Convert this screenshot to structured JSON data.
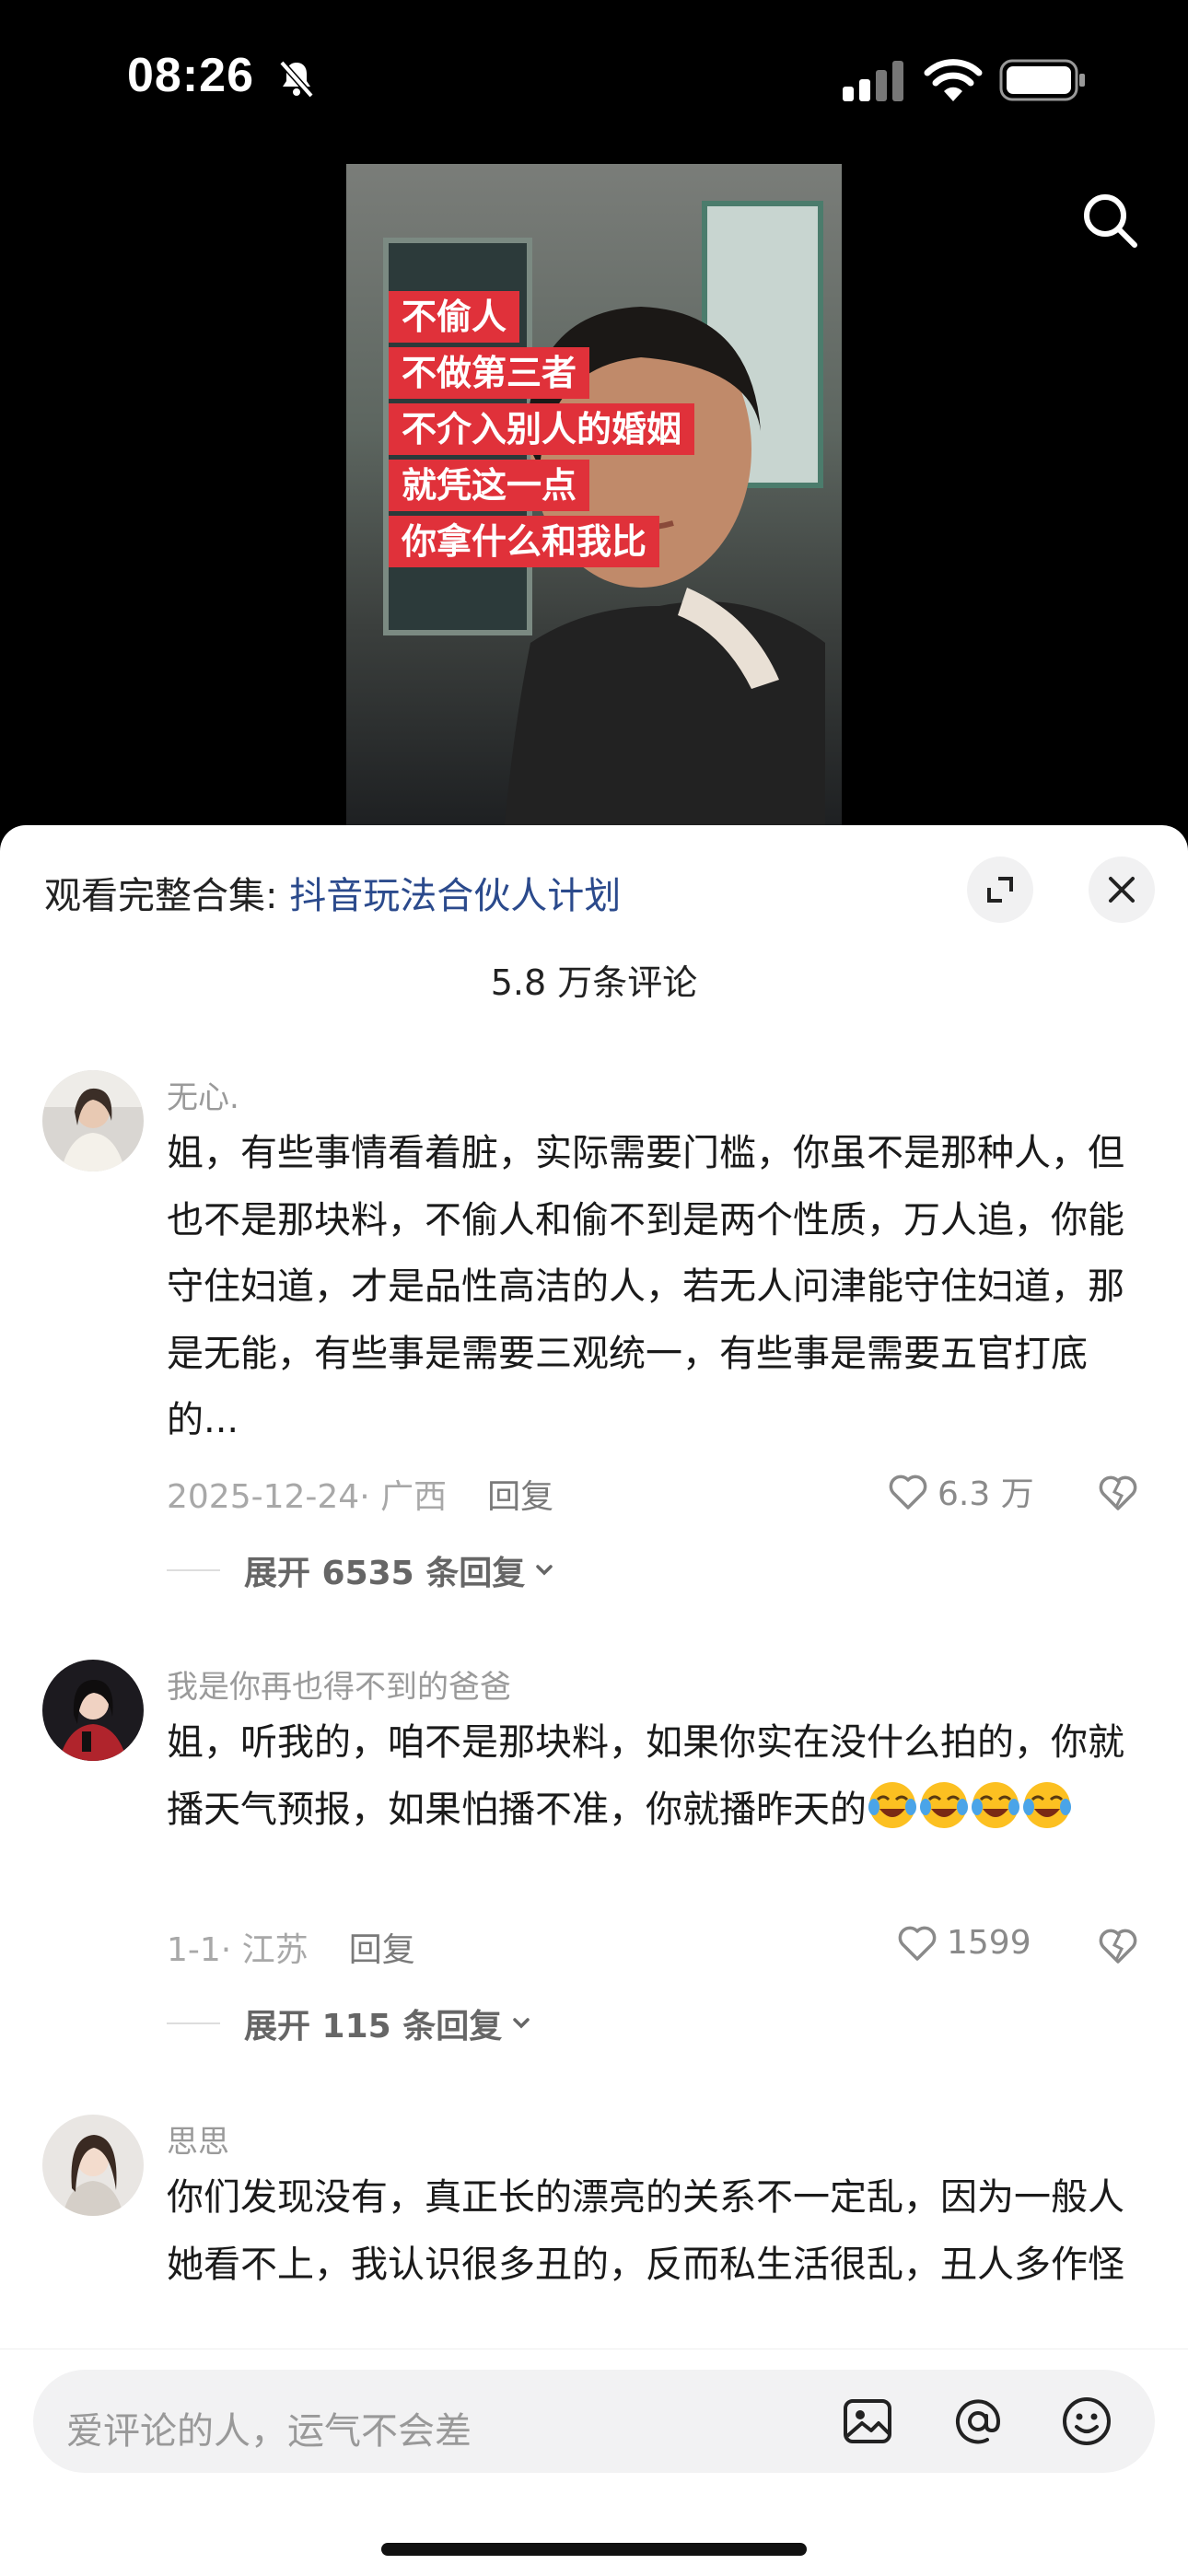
{
  "status": {
    "time": "08:26"
  },
  "video": {
    "captions": [
      "不偷人",
      "不做第三者",
      "不介入别人的婚姻",
      "就凭这一点",
      "你拿什么和我比"
    ]
  },
  "sheet": {
    "collection_prefix": "观看完整合集: ",
    "collection_link": "抖音玩法合伙人计划",
    "comment_count": "5.8 万条评论"
  },
  "comments": [
    {
      "name": "无心.",
      "text": "姐，有些事情看着脏，实际需要门槛，你虽不是那种人，但也不是那块料，不偷人和偷不到是两个性质，万人追，你能守住妇道，才是品性高洁的人，若无人问津能守住妇道，那是无能，有些事是需要三观统一，有些事是需要五官打底的...",
      "meta": "2025-12-24· 广西",
      "reply": "回复",
      "likes": "6.3 万",
      "expand": "展开 6535 条回复"
    },
    {
      "name": "我是你再也得不到的爸爸",
      "text": "姐，听我的，咱不是那块料，如果你实在没什么拍的，你就播天气预报，如果怕播不准，你就播昨天的",
      "meta": "1-1· 江苏",
      "reply": "回复",
      "likes": "1599",
      "expand": "展开 115 条回复"
    },
    {
      "name": "思思",
      "text": "你们发现没有，真正长的漂亮的关系不一定乱，因为一般人她看不上，我认识很多丑的，反而私生活很乱，丑人多作怪是有一定道理的。"
    }
  ],
  "input": {
    "placeholder": "爱评论的人，运气不会差"
  },
  "colors": {
    "caption_bg": "#e0313a",
    "link": "#2b4a8c"
  }
}
